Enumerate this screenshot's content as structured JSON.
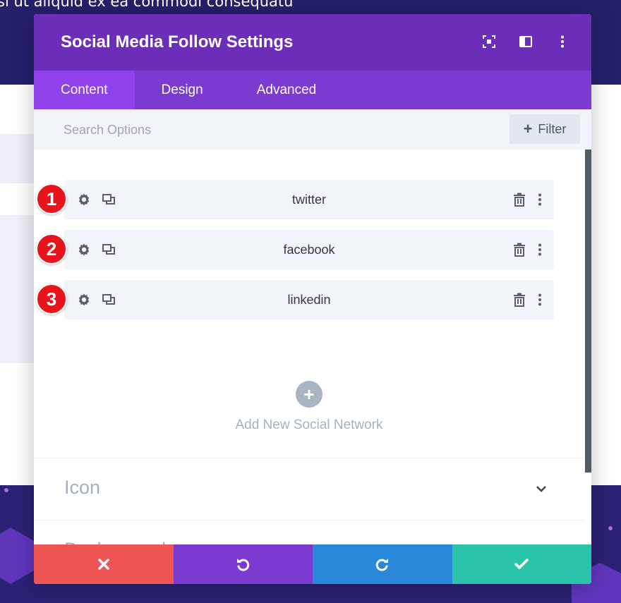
{
  "background": {
    "top_text": "si ut aliquid ex ea commodi consequatu"
  },
  "modal": {
    "title": "Social Media Follow Settings",
    "header_icons": [
      "focus-icon",
      "sidebar-layout-icon",
      "more-vertical-icon"
    ]
  },
  "tabs": [
    {
      "label": "Content",
      "active": true
    },
    {
      "label": "Design",
      "active": false
    },
    {
      "label": "Advanced",
      "active": false
    }
  ],
  "search": {
    "placeholder": "Search Options",
    "value": ""
  },
  "filter": {
    "label": "Filter"
  },
  "networks": [
    {
      "badge": "1",
      "label": "twitter"
    },
    {
      "badge": "2",
      "label": "facebook"
    },
    {
      "badge": "3",
      "label": "linkedin"
    }
  ],
  "add_network": {
    "label": "Add New Social Network"
  },
  "sections": [
    {
      "title": "Icon"
    },
    {
      "title": "Background"
    }
  ],
  "footer": {
    "buttons": [
      {
        "name": "discard",
        "color": "#ef5555"
      },
      {
        "name": "undo",
        "color": "#7b3ad0"
      },
      {
        "name": "redo",
        "color": "#2b87da"
      },
      {
        "name": "save",
        "color": "#29c4a9"
      }
    ]
  },
  "colors": {
    "header": "#6c2eb9",
    "tabs": "#7b3ad0",
    "active_tab": "#8f42ec",
    "badge": "#e8141b"
  }
}
